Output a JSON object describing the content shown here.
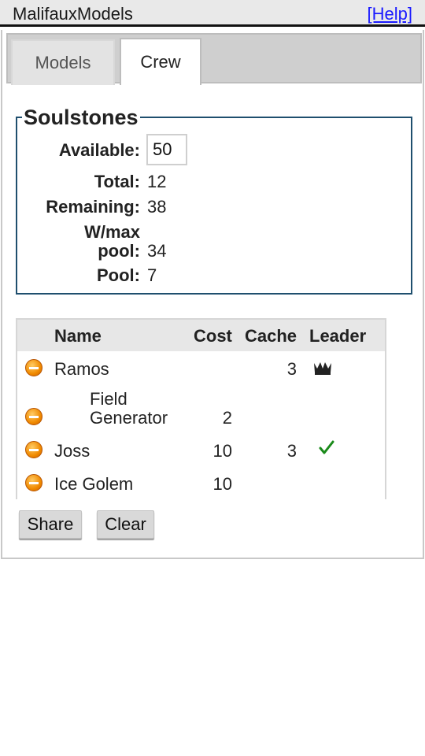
{
  "header": {
    "title": "MalifauxModels",
    "help_link": "[Help]"
  },
  "tabs": [
    {
      "label": "Models",
      "active": false
    },
    {
      "label": "Crew",
      "active": true
    }
  ],
  "soulstones": {
    "legend": "Soulstones",
    "available_label": "Available:",
    "available_value": "50",
    "total_label": "Total:",
    "total_value": "12",
    "remaining_label": "Remaining:",
    "remaining_value": "38",
    "wmax_label_line1": "W/max",
    "wmax_label_line2": "pool:",
    "wmax_value": "34",
    "pool_label": "Pool:",
    "pool_value": "7"
  },
  "crew_table": {
    "columns": [
      "Name",
      "Cost",
      "Cache",
      "Leader"
    ],
    "rows": [
      {
        "name": "Ramos",
        "cost": "",
        "cache": "3",
        "leader_icon": "crown-icon"
      },
      {
        "name_line1": "Field",
        "name_line2": "Generator",
        "cost": "2",
        "cache": "",
        "leader_icon": ""
      },
      {
        "name": "Joss",
        "cost": "10",
        "cache": "3",
        "leader_icon": "check-icon"
      },
      {
        "name": "Ice Golem",
        "cost": "10",
        "cache": "",
        "leader_icon": ""
      }
    ]
  },
  "buttons": {
    "share": "Share",
    "clear": "Clear"
  },
  "colors": {
    "fieldset_border": "#1f4f6e",
    "remove_icon": "#f08a00",
    "check": "#1a8a1a",
    "link": "#1a1aff"
  }
}
